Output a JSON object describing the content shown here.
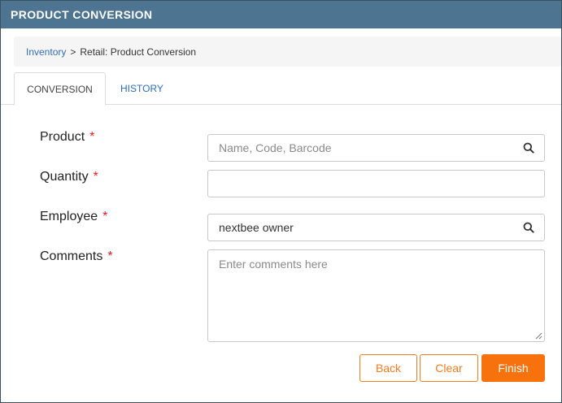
{
  "window": {
    "title": "PRODUCT CONVERSION"
  },
  "breadcrumb": {
    "root": "Inventory",
    "separator": ">",
    "current": "Retail: Product Conversion"
  },
  "tabs": [
    {
      "label": "CONVERSION",
      "active": true
    },
    {
      "label": "HISTORY",
      "active": false
    }
  ],
  "form": {
    "required_marker": "*",
    "product": {
      "label": "Product",
      "value": "",
      "placeholder": "Name, Code, Barcode",
      "icon": "search-icon"
    },
    "quantity": {
      "label": "Quantity",
      "value": ""
    },
    "employee": {
      "label": "Employee",
      "value": "nextbee owner",
      "icon": "search-icon"
    },
    "comments": {
      "label": "Comments",
      "value": "",
      "placeholder": "Enter comments here"
    }
  },
  "actions": {
    "back": "Back",
    "clear": "Clear",
    "finish": "Finish"
  },
  "colors": {
    "titlebar": "#4d7591",
    "accent": "#f7720c",
    "link": "#2f6fb0",
    "required": "#e02020"
  }
}
